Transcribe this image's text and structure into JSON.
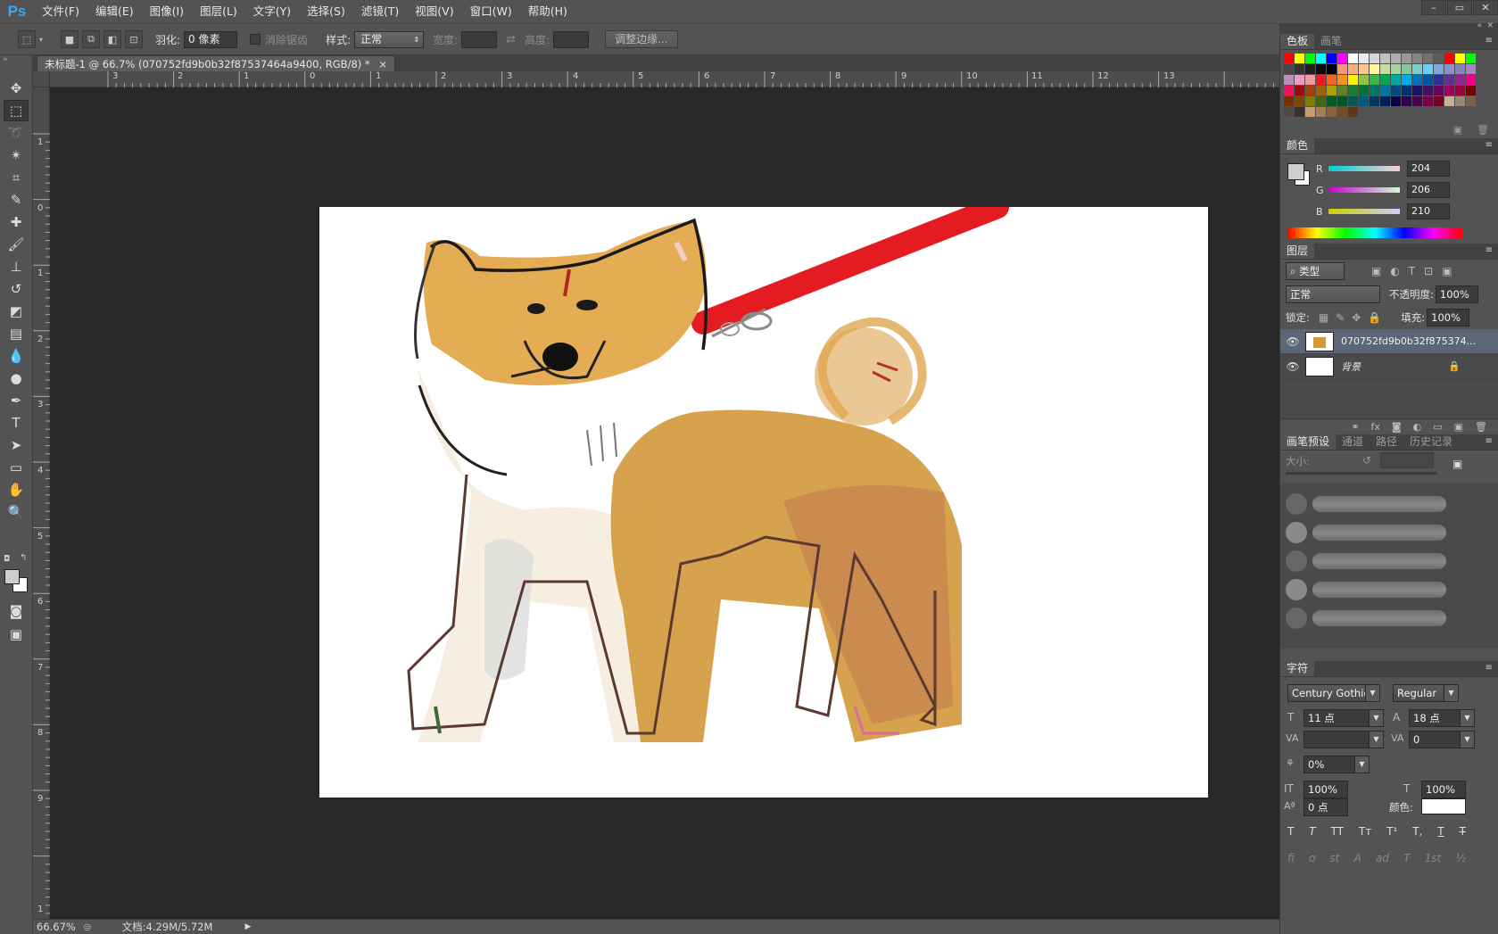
{
  "menubar": {
    "logo": "Ps",
    "items": [
      "文件(F)",
      "编辑(E)",
      "图像(I)",
      "图层(L)",
      "文字(Y)",
      "选择(S)",
      "滤镜(T)",
      "视图(V)",
      "窗口(W)",
      "帮助(H)"
    ],
    "window_controls": [
      "–",
      "▭",
      "✕"
    ]
  },
  "options": {
    "feather_label": "羽化:",
    "feather_value": "0 像素",
    "antialias_label": "消除锯齿",
    "style_label": "样式:",
    "style_value": "正常",
    "width_label": "宽度:",
    "height_label": "高度:",
    "refine_edge_button": "调整边缘..."
  },
  "document": {
    "tab_title": "未标题-1 @ 66.7% (070752fd9b0b32f87537464a9400, RGB/8) *",
    "tab_close": "×"
  },
  "rulers": {
    "h_labels": [
      "3",
      "2",
      "1",
      "0",
      "1",
      "2",
      "3",
      "4",
      "5",
      "6",
      "7",
      "8",
      "9",
      "10",
      "11",
      "12",
      "13"
    ],
    "v_labels": [
      "1",
      "0",
      "1",
      "2",
      "3",
      "4",
      "5",
      "6",
      "7",
      "8",
      "9",
      "1"
    ]
  },
  "status": {
    "zoom": "66.67%",
    "doc_info": "文档:4.29M/5.72M"
  },
  "swatches_panel": {
    "tabs": [
      "色板",
      "画笔"
    ],
    "colors": [
      "#ff0000",
      "#ffff00",
      "#00ff00",
      "#00ffff",
      "#0000ff",
      "#ff00ff",
      "#ffffff",
      "#ebebeb",
      "#d6d6d6",
      "#c2c2c2",
      "#adadad",
      "#999999",
      "#858585",
      "#707070",
      "#5c5c5c",
      "#ff0000",
      "#ffff00",
      "#00ff00",
      "#474747",
      "#333333",
      "#1f1f1f",
      "#0a0a0a",
      "#000000",
      "#f7977a",
      "#f9ad81",
      "#fdc68a",
      "#fff79a",
      "#c4df9b",
      "#a2d39c",
      "#82ca9d",
      "#7bcdc8",
      "#6ecff6",
      "#7ea7d8",
      "#8493ca",
      "#8882be",
      "#a187be",
      "#bc8dbf",
      "#f49ac2",
      "#f6989d",
      "#ed1c24",
      "#f26522",
      "#f7941d",
      "#fff200",
      "#8dc73f",
      "#39b54a",
      "#00a651",
      "#00a99d",
      "#00aeef",
      "#0072bc",
      "#0054a6",
      "#2e3192",
      "#662d91",
      "#92278f",
      "#ec008c",
      "#ed145b",
      "#9e0b0f",
      "#a0410d",
      "#a36209",
      "#aba000",
      "#598527",
      "#1a7b30",
      "#007236",
      "#00746b",
      "#0076a3",
      "#004b80",
      "#003471",
      "#1b1464",
      "#440e62",
      "#630460",
      "#9e005d",
      "#9e0039",
      "#790000",
      "#7b2e00",
      "#7d4900",
      "#827b00",
      "#406618",
      "#005e20",
      "#005826",
      "#005952",
      "#005b7f",
      "#003663",
      "#002157",
      "#0d004c",
      "#32004b",
      "#4b0049",
      "#7b0046",
      "#7a0026",
      "#c7b299",
      "#998675",
      "#736357",
      "#534741",
      "#37302d",
      "#c69c6d",
      "#a67c52",
      "#8c6239",
      "#754c24",
      "#603913"
    ]
  },
  "color_panel": {
    "title": "颜色",
    "channels": [
      {
        "label": "R",
        "value": "204"
      },
      {
        "label": "G",
        "value": "206"
      },
      {
        "label": "B",
        "value": "210"
      }
    ],
    "foreground": "#ccced2"
  },
  "layers_panel": {
    "title": "图层",
    "filter_label": "类型",
    "blend_mode": "正常",
    "opacity_label": "不透明度:",
    "opacity_value": "100%",
    "lock_label": "锁定:",
    "fill_label": "填充:",
    "fill_value": "100%",
    "layers": [
      {
        "name": "070752fd9b0b32f875374...",
        "selected": true,
        "locked": false
      },
      {
        "name": "背景",
        "selected": false,
        "locked": true
      }
    ],
    "footer_icons": [
      "link-icon",
      "fx-icon",
      "mask-icon",
      "adjustment-icon",
      "folder-icon",
      "new-layer-icon",
      "trash-icon"
    ]
  },
  "brush_panel": {
    "tabs": [
      "画笔预设",
      "通道",
      "路径",
      "历史记录"
    ],
    "size_label": "大小:"
  },
  "character_panel": {
    "title": "字符",
    "font_family": "Century Gothic",
    "font_style": "Regular",
    "font_size": "11 点",
    "leading": "18 点",
    "kerning": "",
    "tracking": "0",
    "scale_pct": "0%",
    "vertical_scale": "100%",
    "horizontal_scale": "100%",
    "baseline_shift": "0 点",
    "color_label": "颜色:",
    "style_buttons": [
      "T",
      "T",
      "TT",
      "Tт",
      "T¹",
      "T,",
      "T",
      "T"
    ],
    "opentype_buttons": [
      "fi",
      "ơ",
      "st",
      "A",
      "ad",
      "T",
      "1st",
      "½"
    ]
  }
}
